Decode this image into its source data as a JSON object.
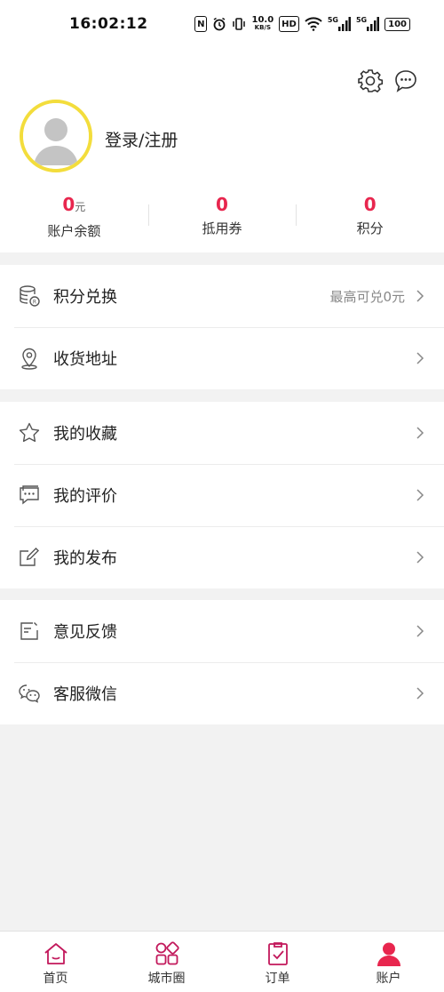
{
  "status_bar": {
    "time": "16:02:12",
    "nfc": "N",
    "speed_value": "10.0",
    "speed_unit": "KB/S",
    "hd": "HD",
    "sim1": "5G",
    "sim2": "5G",
    "battery": "100"
  },
  "header": {
    "login_label": "登录/注册"
  },
  "stats": [
    {
      "value": "0",
      "unit": "元",
      "label": "账户余额"
    },
    {
      "value": "0",
      "unit": "",
      "label": "抵用券"
    },
    {
      "value": "0",
      "unit": "",
      "label": "积分"
    }
  ],
  "menu": {
    "points_exchange": {
      "label": "积分兑换",
      "hint": "最高可兑0元",
      "icon": "database-coin-icon"
    },
    "shipping_address": {
      "label": "收货地址",
      "icon": "location-pin-icon"
    },
    "favorites": {
      "label": "我的收藏",
      "icon": "star-icon"
    },
    "reviews": {
      "label": "我的评价",
      "icon": "chat-bubble-icon"
    },
    "posts": {
      "label": "我的发布",
      "icon": "edit-icon"
    },
    "feedback": {
      "label": "意见反馈",
      "icon": "note-icon"
    },
    "wechat_service": {
      "label": "客服微信",
      "icon": "wechat-icon"
    }
  },
  "tabs": [
    {
      "label": "首页",
      "icon": "home-icon"
    },
    {
      "label": "城市圈",
      "icon": "grid-icon"
    },
    {
      "label": "订单",
      "icon": "clipboard-check-icon"
    },
    {
      "label": "账户",
      "icon": "user-icon",
      "active": true
    }
  ],
  "colors": {
    "accent": "#e8264e",
    "tab_icon": "#c2185b",
    "avatar_ring": "#f3dd3c"
  }
}
